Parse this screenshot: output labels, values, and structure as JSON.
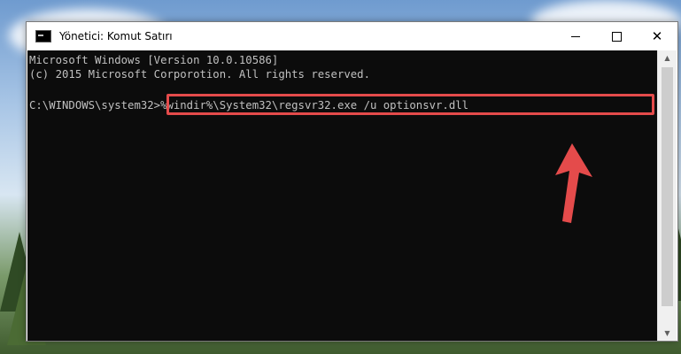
{
  "window": {
    "title": "Yönetici: Komut Satırı",
    "minimize_icon": "minimize-icon",
    "maximize_icon": "maximize-icon",
    "close_symbol": "✕"
  },
  "console": {
    "lines": [
      "Microsoft Windows [Version 10.0.10586]",
      "(c) 2015 Microsoft Corporotion. All rights reserved.",
      "",
      "C:\\WINDOWS\\system32>%windir%\\System32\\regsvr32.exe /u optionsvr.dll"
    ]
  },
  "scrollbar": {
    "up_symbol": "▲",
    "down_symbol": "▼"
  },
  "colors": {
    "console_bg": "#0c0c0c",
    "console_text": "#c0c0c0",
    "highlight": "#e44b4b"
  }
}
